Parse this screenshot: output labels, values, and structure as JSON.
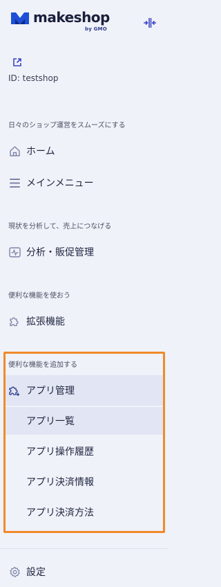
{
  "brand": {
    "name": "makeshop",
    "sub": "by GMO",
    "color": "#2c3a8c"
  },
  "shop": {
    "id_text": "ID: testshop"
  },
  "sections": {
    "daily": "日々のショップ運営をスムーズにする",
    "analysis": "現状を分析して、売上につなげる",
    "features": "便利な機能を使おう",
    "apps": "便利な機能を追加する"
  },
  "nav": {
    "home": {
      "label": "ホーム",
      "icon": "home-icon"
    },
    "main_menu": {
      "label": "メインメニュー",
      "icon": "menu-icon"
    },
    "analytics": {
      "label": "分析・販促管理",
      "icon": "chart-icon"
    },
    "extensions": {
      "label": "拡張機能",
      "icon": "puzzle-icon"
    },
    "app_manage": {
      "label": "アプリ管理",
      "icon": "puzzle-plus-icon"
    },
    "app_sub": [
      {
        "label": "アプリ一覧",
        "active": true
      },
      {
        "label": "アプリ操作履歴",
        "active": false
      },
      {
        "label": "アプリ決済情報",
        "active": false
      },
      {
        "label": "アプリ決済方法",
        "active": false
      }
    ],
    "settings": {
      "label": "設定",
      "icon": "gear-icon"
    }
  },
  "colors": {
    "highlight": "#f0892a",
    "active_bg": "#e2e5f3",
    "sidebar_bg": "#f0f2f9"
  }
}
